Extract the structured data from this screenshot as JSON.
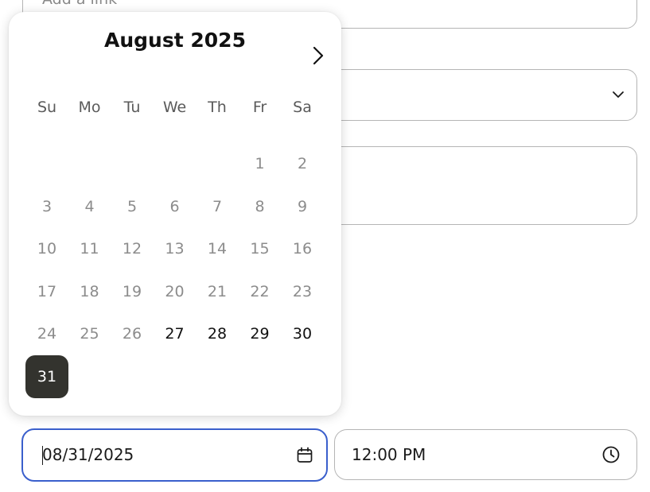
{
  "link_field": {
    "placeholder": "Add a link"
  },
  "calendar": {
    "month_label": "August 2025",
    "weekdays": [
      "Su",
      "Mo",
      "Tu",
      "We",
      "Th",
      "Fr",
      "Sa"
    ],
    "days": [
      {
        "label": "1",
        "state": "past"
      },
      {
        "label": "2",
        "state": "past"
      },
      {
        "label": "3",
        "state": "past"
      },
      {
        "label": "4",
        "state": "past"
      },
      {
        "label": "5",
        "state": "past"
      },
      {
        "label": "6",
        "state": "past"
      },
      {
        "label": "7",
        "state": "past"
      },
      {
        "label": "8",
        "state": "past"
      },
      {
        "label": "9",
        "state": "past"
      },
      {
        "label": "10",
        "state": "past"
      },
      {
        "label": "11",
        "state": "past"
      },
      {
        "label": "12",
        "state": "past"
      },
      {
        "label": "13",
        "state": "past"
      },
      {
        "label": "14",
        "state": "past"
      },
      {
        "label": "15",
        "state": "past"
      },
      {
        "label": "16",
        "state": "past"
      },
      {
        "label": "17",
        "state": "past"
      },
      {
        "label": "18",
        "state": "past"
      },
      {
        "label": "19",
        "state": "past"
      },
      {
        "label": "20",
        "state": "past"
      },
      {
        "label": "21",
        "state": "past"
      },
      {
        "label": "22",
        "state": "past"
      },
      {
        "label": "23",
        "state": "past"
      },
      {
        "label": "24",
        "state": "past"
      },
      {
        "label": "25",
        "state": "past"
      },
      {
        "label": "26",
        "state": "past"
      },
      {
        "label": "27",
        "state": "available"
      },
      {
        "label": "28",
        "state": "available"
      },
      {
        "label": "29",
        "state": "available"
      },
      {
        "label": "30",
        "state": "available"
      },
      {
        "label": "31",
        "state": "selected"
      }
    ],
    "selected_color": "#33332e"
  },
  "date_field": {
    "value": "08/31/2025",
    "icon": "calendar-icon",
    "focus_color": "#3a5fcc"
  },
  "time_field": {
    "value": "12:00 PM",
    "icon": "clock-icon"
  },
  "select_field": {
    "icon": "chevron-down-icon"
  },
  "next_month_icon": "chevron-right-icon"
}
